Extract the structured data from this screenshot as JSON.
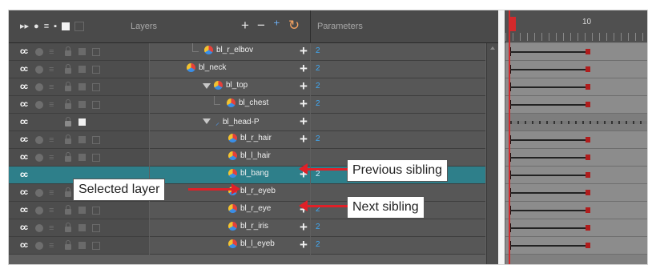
{
  "header": {
    "layers_label": "Layers",
    "parameters_label": "Parameters",
    "timeline_frame": "10"
  },
  "colors": {
    "selected_row": "#2e7f8a",
    "param_value": "#3fa9f5",
    "arrow": "#e02028",
    "playhead": "#d4292b"
  },
  "layers": [
    {
      "name": "bl_r_elbov",
      "param": "2"
    },
    {
      "name": "bl_neck",
      "param": "2"
    },
    {
      "name": "bl_top",
      "param": "2"
    },
    {
      "name": "bl_chest",
      "param": "2"
    },
    {
      "name": "bl_head-P",
      "param": ""
    },
    {
      "name": "bl_r_hair",
      "param": "2"
    },
    {
      "name": "bl_l_hair",
      "param": ""
    },
    {
      "name": "bl_bang",
      "param": "2"
    },
    {
      "name": "bl_r_eyeb",
      "param": ""
    },
    {
      "name": "bl_r_eye",
      "param": "2"
    },
    {
      "name": "bl_r_iris",
      "param": "2"
    },
    {
      "name": "bl_l_eyeb",
      "param": "2"
    }
  ],
  "callouts": {
    "previous_sibling": "Previous sibling",
    "selected_layer": "Selected layer",
    "next_sibling": "Next sibling"
  }
}
